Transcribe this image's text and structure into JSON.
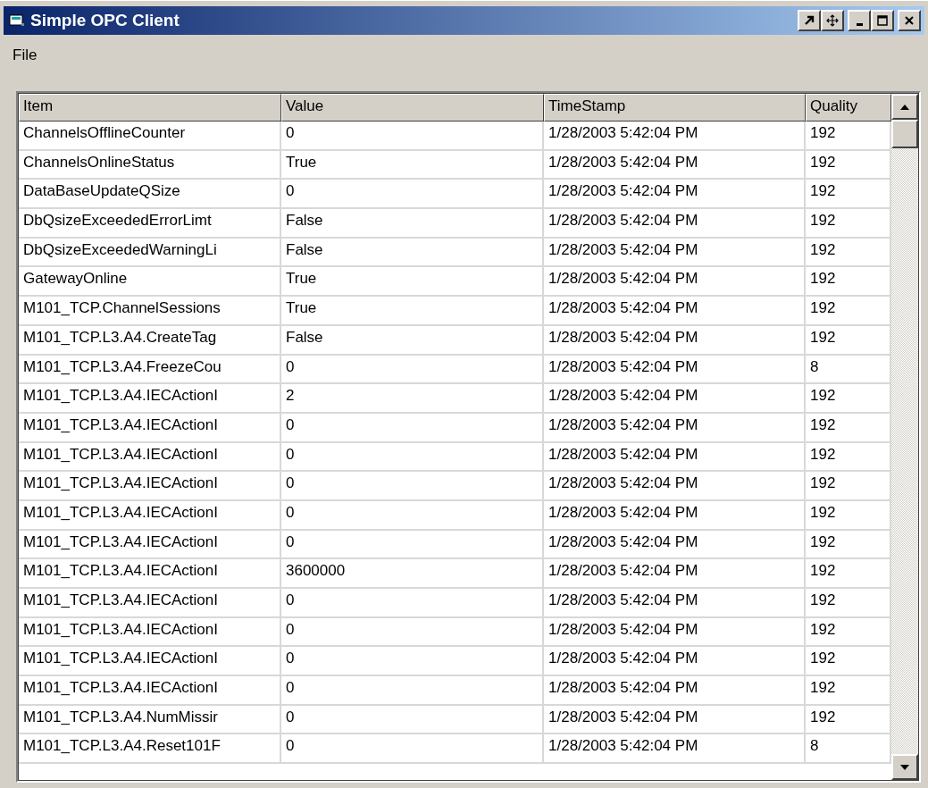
{
  "window": {
    "title": "Simple OPC Client"
  },
  "menu": [
    "File"
  ],
  "table": {
    "columns": [
      "Item",
      "Value",
      "TimeStamp",
      "Quality"
    ],
    "rows": [
      [
        "ChannelsOfflineCounter",
        "0",
        "1/28/2003 5:42:04 PM",
        "192"
      ],
      [
        "ChannelsOnlineStatus",
        "True",
        "1/28/2003 5:42:04 PM",
        "192"
      ],
      [
        "DataBaseUpdateQSize",
        "0",
        "1/28/2003 5:42:04 PM",
        "192"
      ],
      [
        "DbQsizeExceededErrorLimt",
        "False",
        "1/28/2003 5:42:04 PM",
        "192"
      ],
      [
        "DbQsizeExceededWarningLi",
        "False",
        "1/28/2003 5:42:04 PM",
        "192"
      ],
      [
        "GatewayOnline",
        "True",
        "1/28/2003 5:42:04 PM",
        "192"
      ],
      [
        "M101_TCP.ChannelSessions",
        "True",
        "1/28/2003 5:42:04 PM",
        "192"
      ],
      [
        "M101_TCP.L3.A4.CreateTag",
        "False",
        "1/28/2003 5:42:04 PM",
        "192"
      ],
      [
        "M101_TCP.L3.A4.FreezeCou",
        "0",
        "1/28/2003 5:42:04 PM",
        "8"
      ],
      [
        "M101_TCP.L3.A4.IECActionI",
        "2",
        "1/28/2003 5:42:04 PM",
        "192"
      ],
      [
        "M101_TCP.L3.A4.IECActionI",
        "0",
        "1/28/2003 5:42:04 PM",
        "192"
      ],
      [
        "M101_TCP.L3.A4.IECActionI",
        "0",
        "1/28/2003 5:42:04 PM",
        "192"
      ],
      [
        "M101_TCP.L3.A4.IECActionI",
        "0",
        "1/28/2003 5:42:04 PM",
        "192"
      ],
      [
        "M101_TCP.L3.A4.IECActionI",
        "0",
        "1/28/2003 5:42:04 PM",
        "192"
      ],
      [
        "M101_TCP.L3.A4.IECActionI",
        "0",
        "1/28/2003 5:42:04 PM",
        "192"
      ],
      [
        "M101_TCP.L3.A4.IECActionI",
        "3600000",
        "1/28/2003 5:42:04 PM",
        "192"
      ],
      [
        "M101_TCP.L3.A4.IECActionI",
        "0",
        "1/28/2003 5:42:04 PM",
        "192"
      ],
      [
        "M101_TCP.L3.A4.IECActionI",
        "0",
        "1/28/2003 5:42:04 PM",
        "192"
      ],
      [
        "M101_TCP.L3.A4.IECActionI",
        "0",
        "1/28/2003 5:42:04 PM",
        "192"
      ],
      [
        "M101_TCP.L3.A4.IECActionI",
        "0",
        "1/28/2003 5:42:04 PM",
        "192"
      ],
      [
        "M101_TCP.L3.A4.NumMissir",
        "0",
        "1/28/2003 5:42:04 PM",
        "192"
      ],
      [
        "M101_TCP.L3.A4.Reset101F",
        "0",
        "1/28/2003 5:42:04 PM",
        "8"
      ]
    ]
  }
}
